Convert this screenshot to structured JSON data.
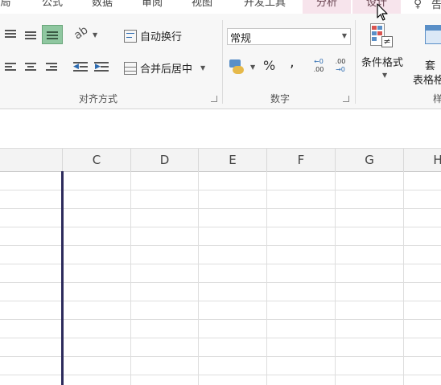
{
  "tabs": [
    "局",
    "公式",
    "数据",
    "审阅",
    "视图",
    "开发工具",
    "分析",
    "设计"
  ],
  "tell_me_glyph": "♀",
  "tell_me_text": "告",
  "alignment": {
    "wrap_text": "自动换行",
    "merge_center": "合并后居中",
    "group_label": "对齐方式"
  },
  "number": {
    "format_value": "常规",
    "percent": "%",
    "comma": ",",
    "increase_decimal_top": "←0",
    "increase_decimal_bottom": ".00",
    "decrease_decimal_top": ".00",
    "decrease_decimal_bottom": "→0",
    "group_label": "数字"
  },
  "styles": {
    "conditional_format": "条件格式",
    "table_format_top": "套",
    "table_format_bottom": "表格格",
    "group_label_partial": "样"
  },
  "columns": [
    "C",
    "D",
    "E",
    "F",
    "G",
    "H"
  ],
  "colors": {
    "context_tab_bg": "#f7e4ec",
    "active_align_bg": "#8fc7a0",
    "frozen_line": "#2d2b5c"
  }
}
